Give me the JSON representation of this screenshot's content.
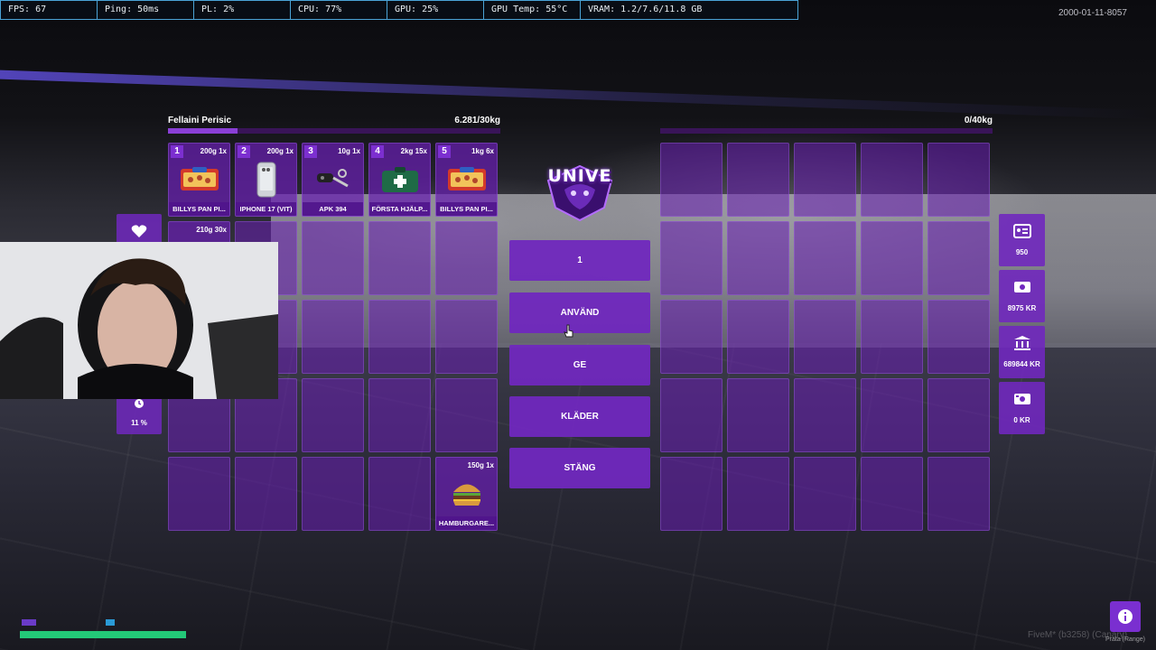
{
  "hud": {
    "fps": "FPS: 67",
    "ping": "Ping: 50ms",
    "pl": "PL: 2%",
    "cpu": "CPU: 77%",
    "gpu": "GPU: 25%",
    "gpu_temp": "GPU Temp: 55°C",
    "vram": "VRAM: 1.2/7.6/11.8 GB"
  },
  "date_stamp": "2000-01-11-8057",
  "player_inventory": {
    "owner": "Fellaini Perisic",
    "weight": "6.281/30kg",
    "weight_fraction": 0.21,
    "slots": [
      {
        "num": "1",
        "weight": "200g 1x",
        "label": "BILLYS PAN PI...",
        "icon": "pizza-box-icon"
      },
      {
        "num": "2",
        "weight": "200g 1x",
        "label": "IPHONE 17 (VIT)",
        "icon": "phone-icon"
      },
      {
        "num": "3",
        "weight": "10g 1x",
        "label": "APK 394",
        "icon": "car-keys-icon"
      },
      {
        "num": "4",
        "weight": "2kg 15x",
        "label": "FÖRSTA HJÄLP...",
        "icon": "first-aid-kit-icon"
      },
      {
        "num": "5",
        "weight": "1kg 6x",
        "label": "BILLYS PAN PI...",
        "icon": "pizza-box-icon"
      },
      {
        "num": "",
        "weight": "210g 30x",
        "label": "",
        "icon": ""
      },
      {
        "num": "",
        "weight": "",
        "label": "",
        "icon": ""
      },
      {
        "num": "",
        "weight": "",
        "label": "",
        "icon": ""
      },
      {
        "num": "",
        "weight": "",
        "label": "",
        "icon": ""
      },
      {
        "num": "",
        "weight": "",
        "label": "",
        "icon": ""
      },
      {
        "num": "",
        "weight": "",
        "label": "",
        "icon": ""
      },
      {
        "num": "",
        "weight": "",
        "label": "",
        "icon": ""
      },
      {
        "num": "",
        "weight": "",
        "label": "",
        "icon": ""
      },
      {
        "num": "",
        "weight": "",
        "label": "",
        "icon": ""
      },
      {
        "num": "",
        "weight": "",
        "label": "",
        "icon": ""
      },
      {
        "num": "",
        "weight": "",
        "label": "",
        "icon": ""
      },
      {
        "num": "",
        "weight": "",
        "label": "",
        "icon": ""
      },
      {
        "num": "",
        "weight": "",
        "label": "",
        "icon": ""
      },
      {
        "num": "",
        "weight": "",
        "label": "",
        "icon": ""
      },
      {
        "num": "",
        "weight": "",
        "label": "",
        "icon": ""
      },
      {
        "num": "",
        "weight": "",
        "label": "",
        "icon": ""
      },
      {
        "num": "",
        "weight": "",
        "label": "",
        "icon": ""
      },
      {
        "num": "",
        "weight": "",
        "label": "",
        "icon": ""
      },
      {
        "num": "",
        "weight": "",
        "label": "",
        "icon": ""
      },
      {
        "num": "",
        "weight": "150g 1x",
        "label": "HAMBURGARE...",
        "icon": "hamburger-icon"
      }
    ]
  },
  "other_inventory": {
    "weight": "0/40kg",
    "weight_fraction": 0.0
  },
  "logo": {
    "text": "UNIVE"
  },
  "actions": {
    "amount": "1",
    "use": "ANVÄND",
    "give": "GE",
    "clothes": "KLÄDER",
    "close": "STÄNG"
  },
  "money": {
    "id": "950",
    "cash": "8975 KR",
    "bank": "689844 KR",
    "black": "0 KR"
  },
  "status": {
    "stress": "11 %"
  },
  "footer": {
    "build": "FiveM* (b3258) (Canary)",
    "prata": "Prata (Range)"
  },
  "colors": {
    "accent": "#7c2fd0",
    "slot": "#681eb2",
    "health_bar": "#23c878"
  }
}
